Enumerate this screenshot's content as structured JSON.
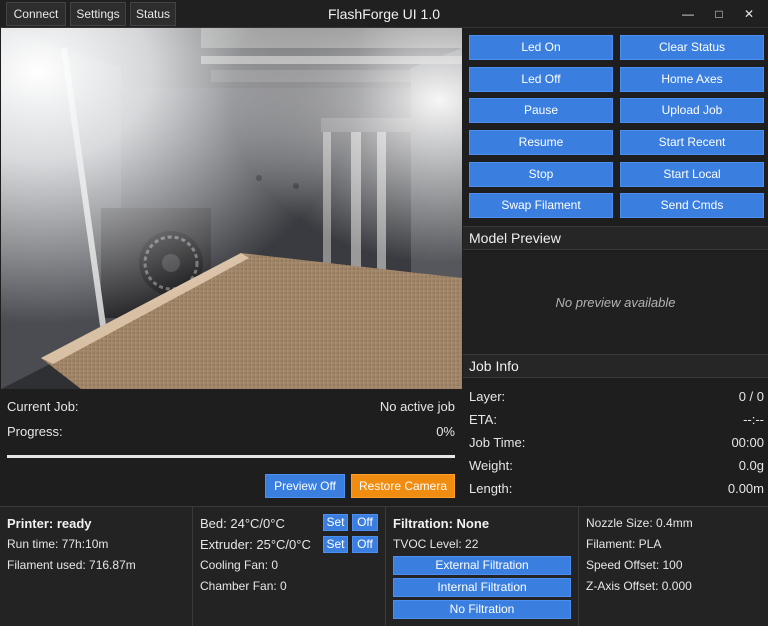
{
  "app": {
    "title": "FlashForge UI 1.0"
  },
  "menu": {
    "connect": "Connect",
    "settings": "Settings",
    "status": "Status"
  },
  "window": {
    "minimize": "—",
    "maximize": "□",
    "close": "✕"
  },
  "controls": {
    "led_on": "Led On",
    "clear_status": "Clear Status",
    "led_off": "Led Off",
    "home_axes": "Home Axes",
    "pause": "Pause",
    "upload_job": "Upload Job",
    "resume": "Resume",
    "start_recent": "Start Recent",
    "stop": "Stop",
    "start_local": "Start Local",
    "swap_filament": "Swap Filament",
    "send_cmds": "Send Cmds"
  },
  "model_preview": {
    "header": "Model Preview",
    "empty_text": "No preview available"
  },
  "job_info": {
    "header": "Job Info",
    "layer_label": "Layer:",
    "layer_value": "0 / 0",
    "eta_label": "ETA:",
    "eta_value": "--:--",
    "job_time_label": "Job Time:",
    "job_time_value": "00:00",
    "weight_label": "Weight:",
    "weight_value": "0.0g",
    "length_label": "Length:",
    "length_value": "0.00m"
  },
  "current_job": {
    "label": "Current Job:",
    "value": "No active job",
    "progress_label": "Progress:",
    "progress_value": "0%",
    "progress_fraction": 0
  },
  "camera_buttons": {
    "preview_off": "Preview Off",
    "restore_camera": "Restore Camera"
  },
  "printer": {
    "status": "Printer: ready",
    "run_time": "Run time: 77h:10m",
    "filament_used": "Filament used: 716.87m"
  },
  "temps": {
    "bed": "Bed: 24°C/0°C",
    "extruder": "Extruder: 25°C/0°C",
    "cooling_fan": "Cooling Fan: 0",
    "chamber_fan": "Chamber Fan: 0",
    "set": "Set",
    "off": "Off"
  },
  "filtration": {
    "header": "Filtration: None",
    "tvoc": "TVOC Level: 22",
    "external": "External Filtration",
    "internal": "Internal Filtration",
    "none": "No Filtration"
  },
  "machine": {
    "nozzle": "Nozzle Size: 0.4mm",
    "filament": "Filament: PLA",
    "speed_offset": "Speed Offset: 100",
    "z_offset": "Z-Axis Offset: 0.000"
  },
  "colors": {
    "accent": "#3a7fe0",
    "warning": "#f08c10",
    "background": "#1e1e1e"
  }
}
